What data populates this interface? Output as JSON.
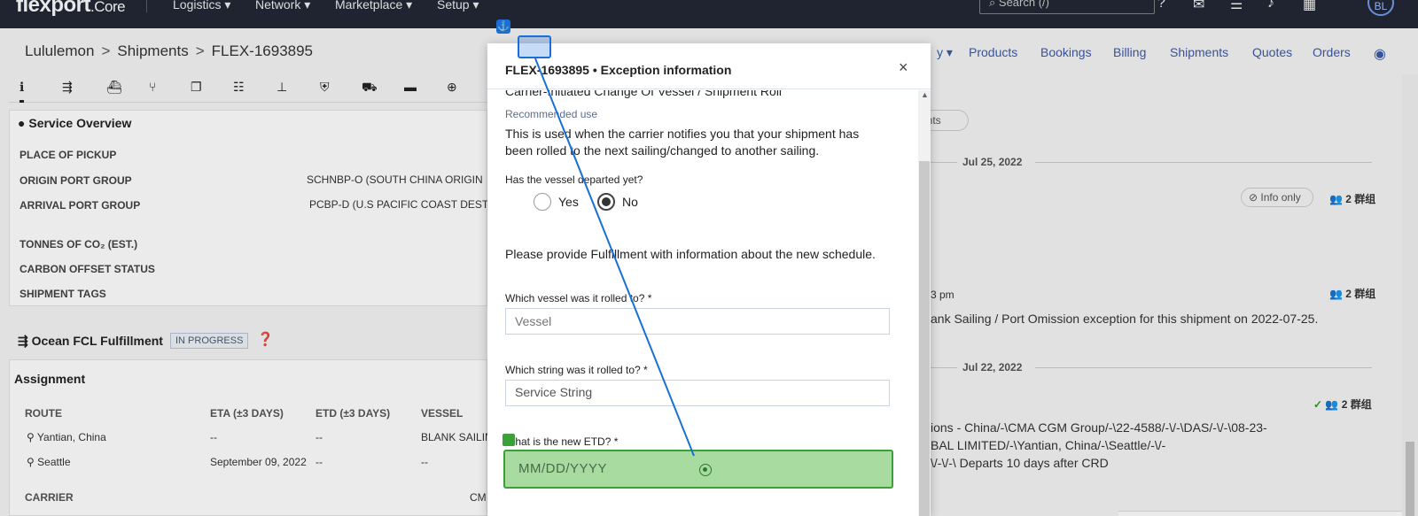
{
  "topnav": {
    "brand": "flexport",
    "brand_suffix": ".Core",
    "menus": [
      "Logistics ▾",
      "Network ▾",
      "Marketplace ▾",
      "Setup ▾"
    ],
    "search_placeholder": "Search (/)",
    "avatar": "BL"
  },
  "breadcrumb": [
    "Lululemon",
    "Shipments",
    "FLEX-1693895"
  ],
  "overview": {
    "title": "Service Overview",
    "rows": [
      {
        "label": "PLACE OF PICKUP",
        "value": ""
      },
      {
        "label": "ORIGIN PORT GROUP",
        "value": "SCHNBP-O (SOUTH CHINA ORIGIN"
      },
      {
        "label": "ARRIVAL PORT GROUP",
        "value": "PCBP-D (U.S PACIFIC COAST DEST"
      },
      {
        "label": "TONNES OF CO₂ (EST.)",
        "value": ""
      },
      {
        "label": "CARBON OFFSET STATUS",
        "value": ""
      },
      {
        "label": "SHIPMENT TAGS",
        "value": ""
      }
    ]
  },
  "fulfillment": {
    "title": "Ocean FCL Fulfillment",
    "status": "IN PROGRESS",
    "assignment": "Assignment",
    "columns": [
      "ROUTE",
      "ETA (±3 DAYS)",
      "ETD (±3 DAYS)",
      "VESSEL"
    ],
    "rows": [
      {
        "route": "Yantian, China",
        "eta": "--",
        "etd": "--",
        "vessel": "BLANK SAILIN"
      },
      {
        "route": "Seattle",
        "eta": "September 09, 2022",
        "etd": "--",
        "vessel": "--"
      }
    ],
    "carrier_label": "CARRIER",
    "carrier_value": "CM"
  },
  "right_tabs": [
    "Products",
    "Bookings",
    "Billing",
    "Shipments",
    "Quotes",
    "Orders"
  ],
  "right_tab_truncated": "y ▾",
  "timeline": {
    "events_pill": "vents",
    "date1": "Jul 25, 2022",
    "info_only": "Info only",
    "group1": "2 群组",
    "time2": "3 pm",
    "group2": "2 群组",
    "event2_text": "ank Sailing / Port Omission exception for this shipment on 2022-07-25.",
    "date2": "Jul 22, 2022",
    "group3": "2 群组",
    "event3_lines": [
      "ions - China/-\\CMA CGM Group/-\\22-4588/-\\/-\\DAS/-\\/-\\08-23-",
      "BAL LIMITED/-\\Yantian, China/-\\Seattle/-\\/-",
      "\\/-\\/-\\ Departs 10 days after CRD"
    ]
  },
  "modal": {
    "title": "FLEX-1693895 • Exception information",
    "close": "×",
    "exception_type": "Carrier-Initiated Change Of Vessel / Shipment Roll",
    "recommended_label": "Recommended use",
    "recommended_text_1": "This is used when the carrier notifies you that your shipment has",
    "recommended_text_2": "been rolled to the next sailing/changed to another sailing.",
    "departed_q": "Has the vessel departed yet?",
    "yes": "Yes",
    "no": "No",
    "selected": "No",
    "provide_text": "Please provide Fulfillment with information about the new schedule.",
    "vessel_q": "Which vessel was it rolled to? *",
    "vessel_placeholder": "Vessel",
    "string_q": "Which string was it rolled to? *",
    "string_placeholder": "Service String",
    "etd_q": "What is the new ETD? *",
    "etd_placeholder": "MM/DD/YYYY"
  },
  "colors": {
    "accent": "#3a5aa8",
    "highlight": "#3aa13a",
    "nav_bg": "#1f2430"
  }
}
